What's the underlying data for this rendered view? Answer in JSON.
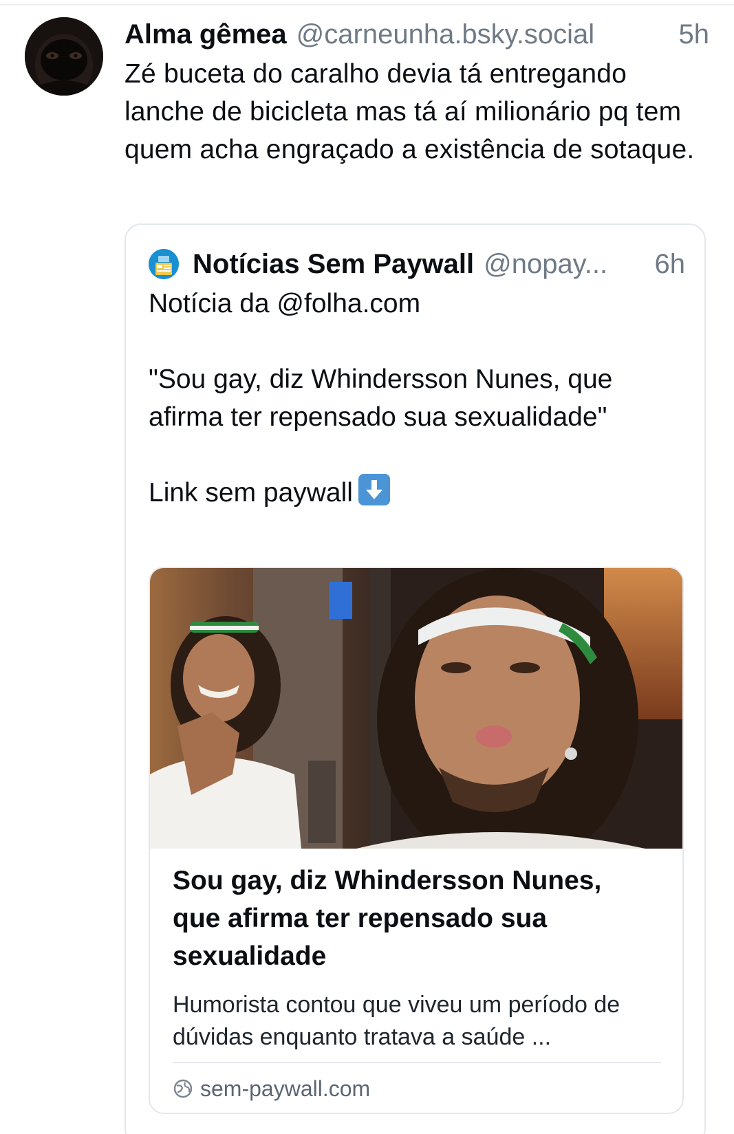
{
  "post": {
    "author": "Alma gêmea",
    "handle": "@carneunha.bsky.social",
    "time": "5h",
    "text": "Zé buceta do caralho devia tá entregando lanche de bicicleta mas tá aí milionário pq tem quem acha engraçado a existência de sotaque."
  },
  "quote": {
    "author": "Notícias Sem Paywall",
    "handle": "@nopay...",
    "time": "6h",
    "line1": "Notícia da @folha.com",
    "line2": "\"Sou gay, diz Whindersson Nunes, que afirma ter repensado sua sexualidade\"",
    "line3": "Link sem paywall",
    "emoji": "down-arrow-emoji"
  },
  "link_card": {
    "title": "Sou gay, diz Whindersson Nunes, que afirma ter repensado sua sexualidade",
    "description": "Humorista contou que viveu um período de dúvidas enquanto tratava a saúde ...",
    "domain": "sem-paywall.com"
  },
  "colors": {
    "text": "#0b0f14",
    "muted": "#6f7a86",
    "border": "#e4e8ec",
    "quote_avatar": "#1a8fd1",
    "emoji_bg": "#4b95d6"
  }
}
